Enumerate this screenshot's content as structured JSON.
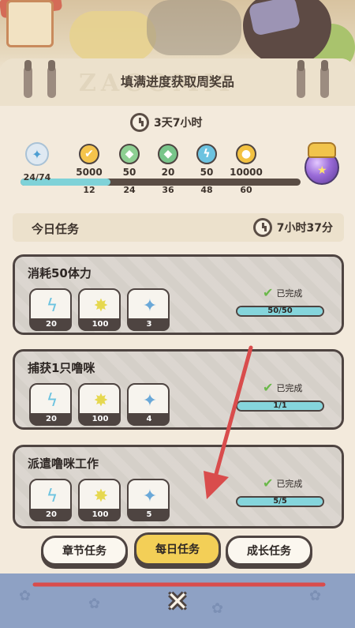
{
  "header": {
    "title": "填满进度获取周奖品",
    "watermark": "ZACOMM",
    "timer": "3天7小时"
  },
  "progress": {
    "current": "24/74",
    "current_fraction": 0.32,
    "milestones": [
      {
        "amount": "5000",
        "threshold": "12",
        "icon": "coin-check-icon",
        "color": "#f5c44c"
      },
      {
        "amount": "50",
        "threshold": "24",
        "icon": "gem-icon",
        "color": "#8dcf92"
      },
      {
        "amount": "20",
        "threshold": "36",
        "icon": "green-crystal-icon",
        "color": "#78c58a"
      },
      {
        "amount": "50",
        "threshold": "48",
        "icon": "lightning-icon",
        "color": "#6cc3e0"
      },
      {
        "amount": "10000",
        "threshold": "60",
        "icon": "gold-coin-icon",
        "color": "#f3c241"
      }
    ],
    "grand_prize_icon": "purple-fruit-icon"
  },
  "daily": {
    "title": "今日任务",
    "timer": "7小时37分"
  },
  "tasks": [
    {
      "name": "消耗50体力",
      "rewards": [
        {
          "qty": "20",
          "icon": "lightning-icon",
          "color": "#6cc3e0"
        },
        {
          "qty": "100",
          "icon": "star-powder-icon",
          "color": "#e6d84f"
        },
        {
          "qty": "3",
          "icon": "blue-star-icon",
          "color": "#6aa8d8"
        }
      ],
      "status": "已完成",
      "progress_text": "50/50",
      "progress_fraction": 1.0
    },
    {
      "name": "捕获1只噜咪",
      "rewards": [
        {
          "qty": "20",
          "icon": "lightning-icon",
          "color": "#6cc3e0"
        },
        {
          "qty": "100",
          "icon": "star-powder-icon",
          "color": "#e6d84f"
        },
        {
          "qty": "4",
          "icon": "blue-star-icon",
          "color": "#6aa8d8"
        }
      ],
      "status": "已完成",
      "progress_text": "1/1",
      "progress_fraction": 1.0
    },
    {
      "name": "派遣噜咪工作",
      "rewards": [
        {
          "qty": "20",
          "icon": "lightning-icon",
          "color": "#6cc3e0"
        },
        {
          "qty": "100",
          "icon": "star-powder-icon",
          "color": "#e6d84f"
        },
        {
          "qty": "5",
          "icon": "blue-star-icon",
          "color": "#6aa8d8"
        }
      ],
      "status": "已完成",
      "progress_text": "5/5",
      "progress_fraction": 1.0
    }
  ],
  "tabs": [
    {
      "label": "章节任务",
      "active": false
    },
    {
      "label": "每日任务",
      "active": true
    },
    {
      "label": "成长任务",
      "active": false
    }
  ],
  "close_icon": "close-icon",
  "annotation_color": "#d94c4c"
}
